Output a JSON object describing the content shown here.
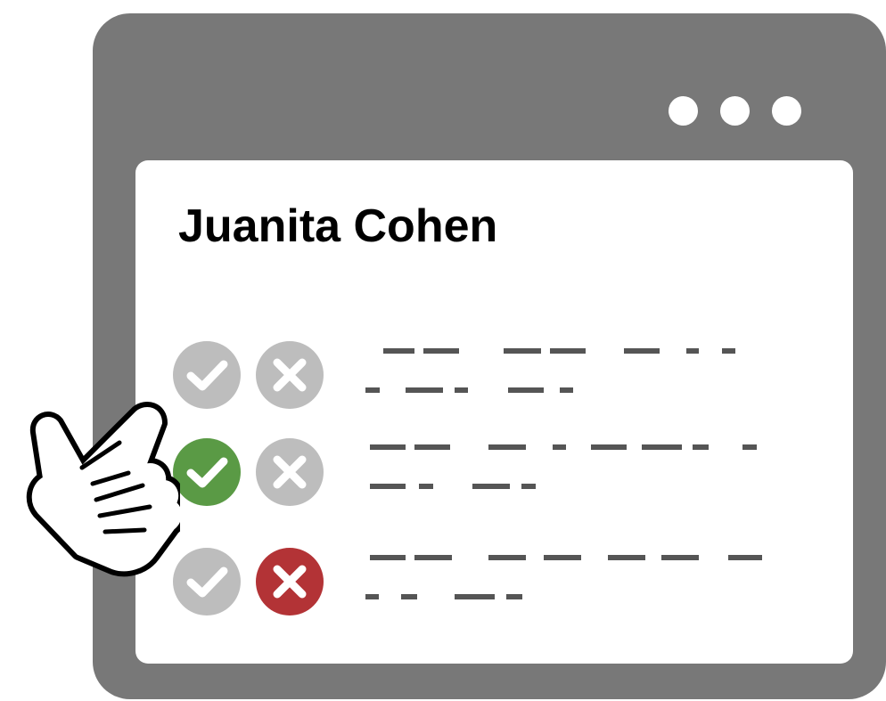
{
  "window": {
    "title_dots": [
      "window-dot-1",
      "window-dot-2",
      "window-dot-3"
    ]
  },
  "profile": {
    "name": "Juanita Cohen"
  },
  "colors": {
    "frame": "#787878",
    "inactive": "#bdbdbd",
    "approve_active": "#5a9a45",
    "reject_active": "#b33336",
    "placeholder_line": "#555555"
  },
  "rows": [
    {
      "approve_state": "inactive",
      "reject_state": "inactive"
    },
    {
      "approve_state": "active",
      "reject_state": "inactive"
    },
    {
      "approve_state": "inactive",
      "reject_state": "active"
    }
  ],
  "icons": {
    "approve": "check-icon",
    "reject": "x-icon",
    "cursor": "pointing-hand-icon"
  }
}
